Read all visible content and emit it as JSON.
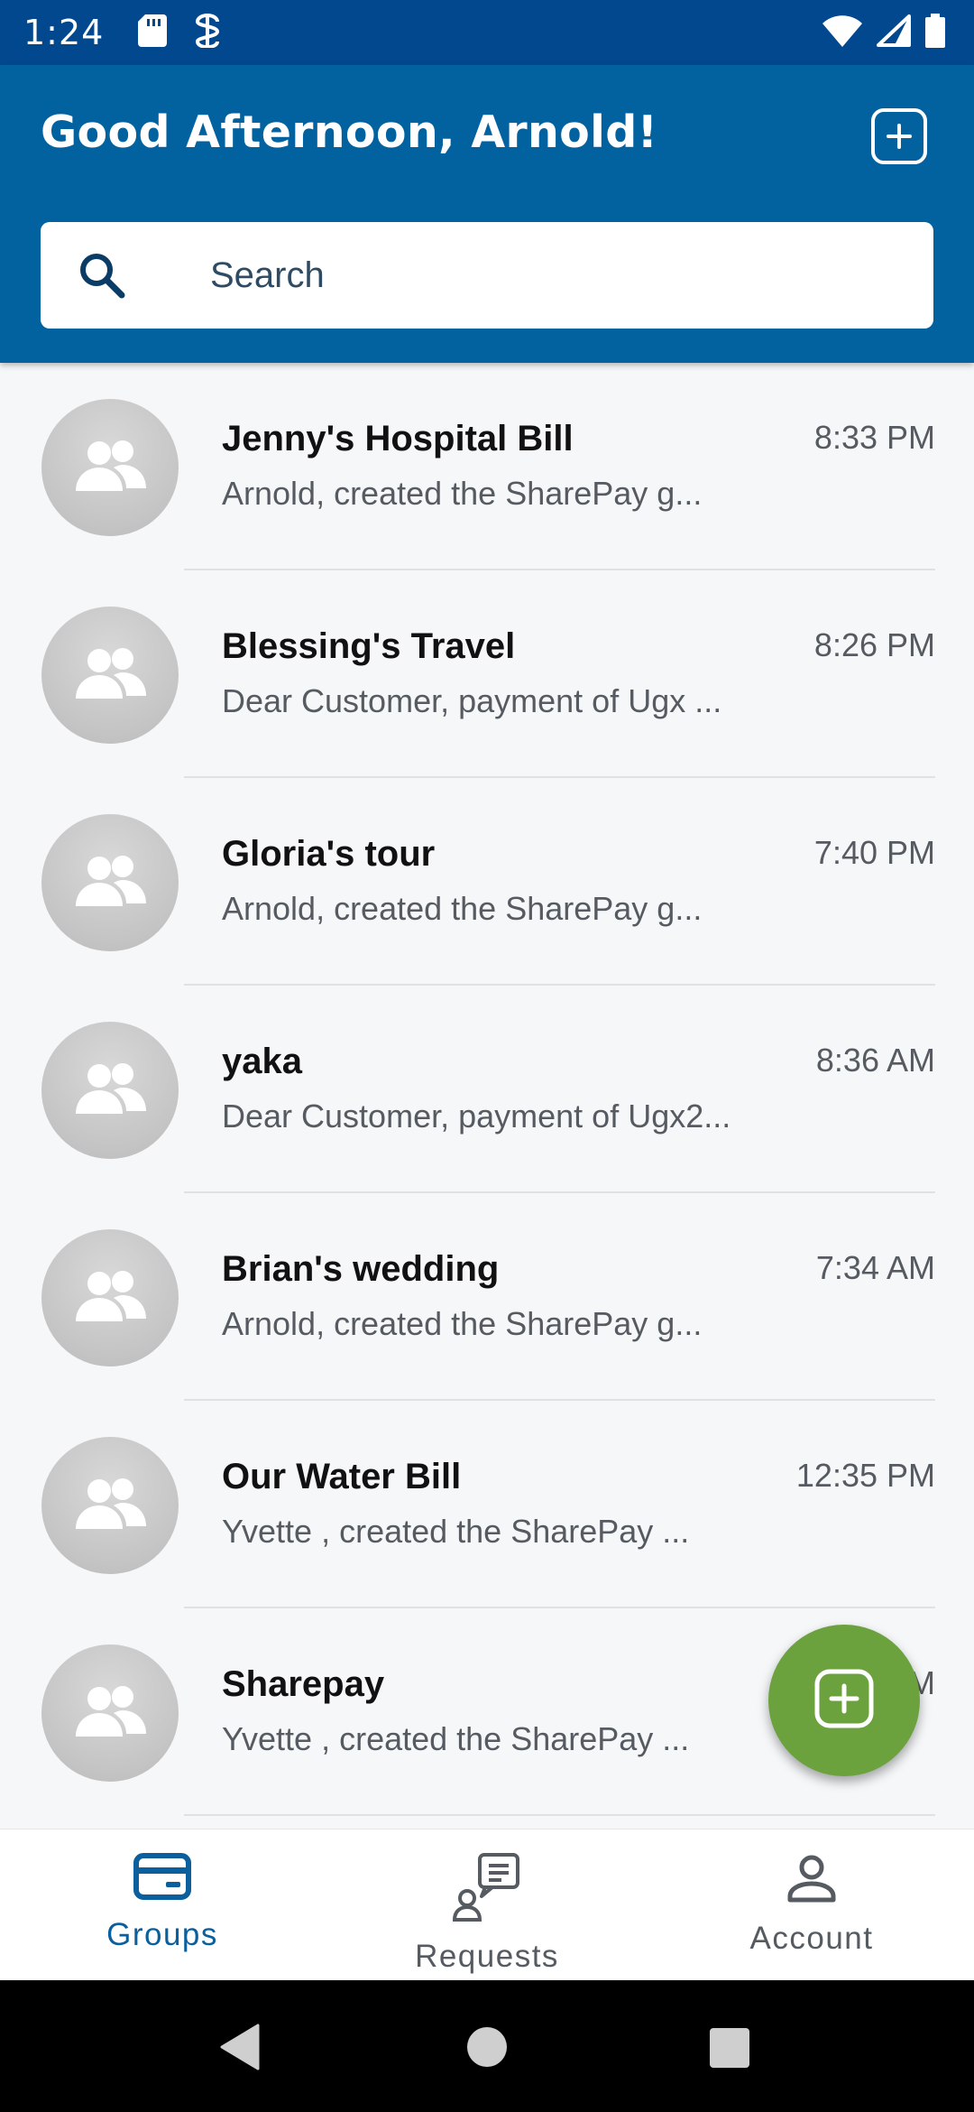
{
  "status_bar": {
    "time": "1:24",
    "left_icons": [
      "sd-card-icon",
      "sim-icon"
    ],
    "right_icons": [
      "wifi-icon",
      "signal-icon",
      "battery-icon"
    ]
  },
  "header": {
    "greeting": "Good Afternoon, Arnold!",
    "add_icon": "add-square-icon"
  },
  "search": {
    "placeholder": "Search",
    "value": ""
  },
  "groups": [
    {
      "title": "Jenny's Hospital Bill",
      "preview": "Arnold, created the SharePay g...",
      "time": "8:33 PM"
    },
    {
      "title": "Blessing's Travel",
      "preview": "Dear Customer, payment of Ugx ...",
      "time": "8:26 PM"
    },
    {
      "title": "Gloria's tour",
      "preview": "Arnold, created the SharePay g...",
      "time": "7:40 PM"
    },
    {
      "title": "yaka",
      "preview": "Dear Customer, payment of Ugx2...",
      "time": "8:36 AM"
    },
    {
      "title": "Brian's wedding",
      "preview": "Arnold, created the SharePay g...",
      "time": "7:34 AM"
    },
    {
      "title": "Our Water Bill",
      "preview": "Yvette , created the SharePay ...",
      "time": "12:35 PM"
    },
    {
      "title": "Sharepay",
      "preview": "Yvette , created the SharePay ...",
      "time": "M"
    }
  ],
  "fab": {
    "icon": "add-square-icon",
    "color": "#6ba23e"
  },
  "bottom_nav": [
    {
      "label": "Groups",
      "icon": "card-icon",
      "active": true
    },
    {
      "label": "Requests",
      "icon": "requests-icon",
      "active": false
    },
    {
      "label": "Account",
      "icon": "person-icon",
      "active": false
    }
  ],
  "colors": {
    "header": "#0262a0",
    "status_bar": "#02488f",
    "accent": "#0a5f9c"
  }
}
